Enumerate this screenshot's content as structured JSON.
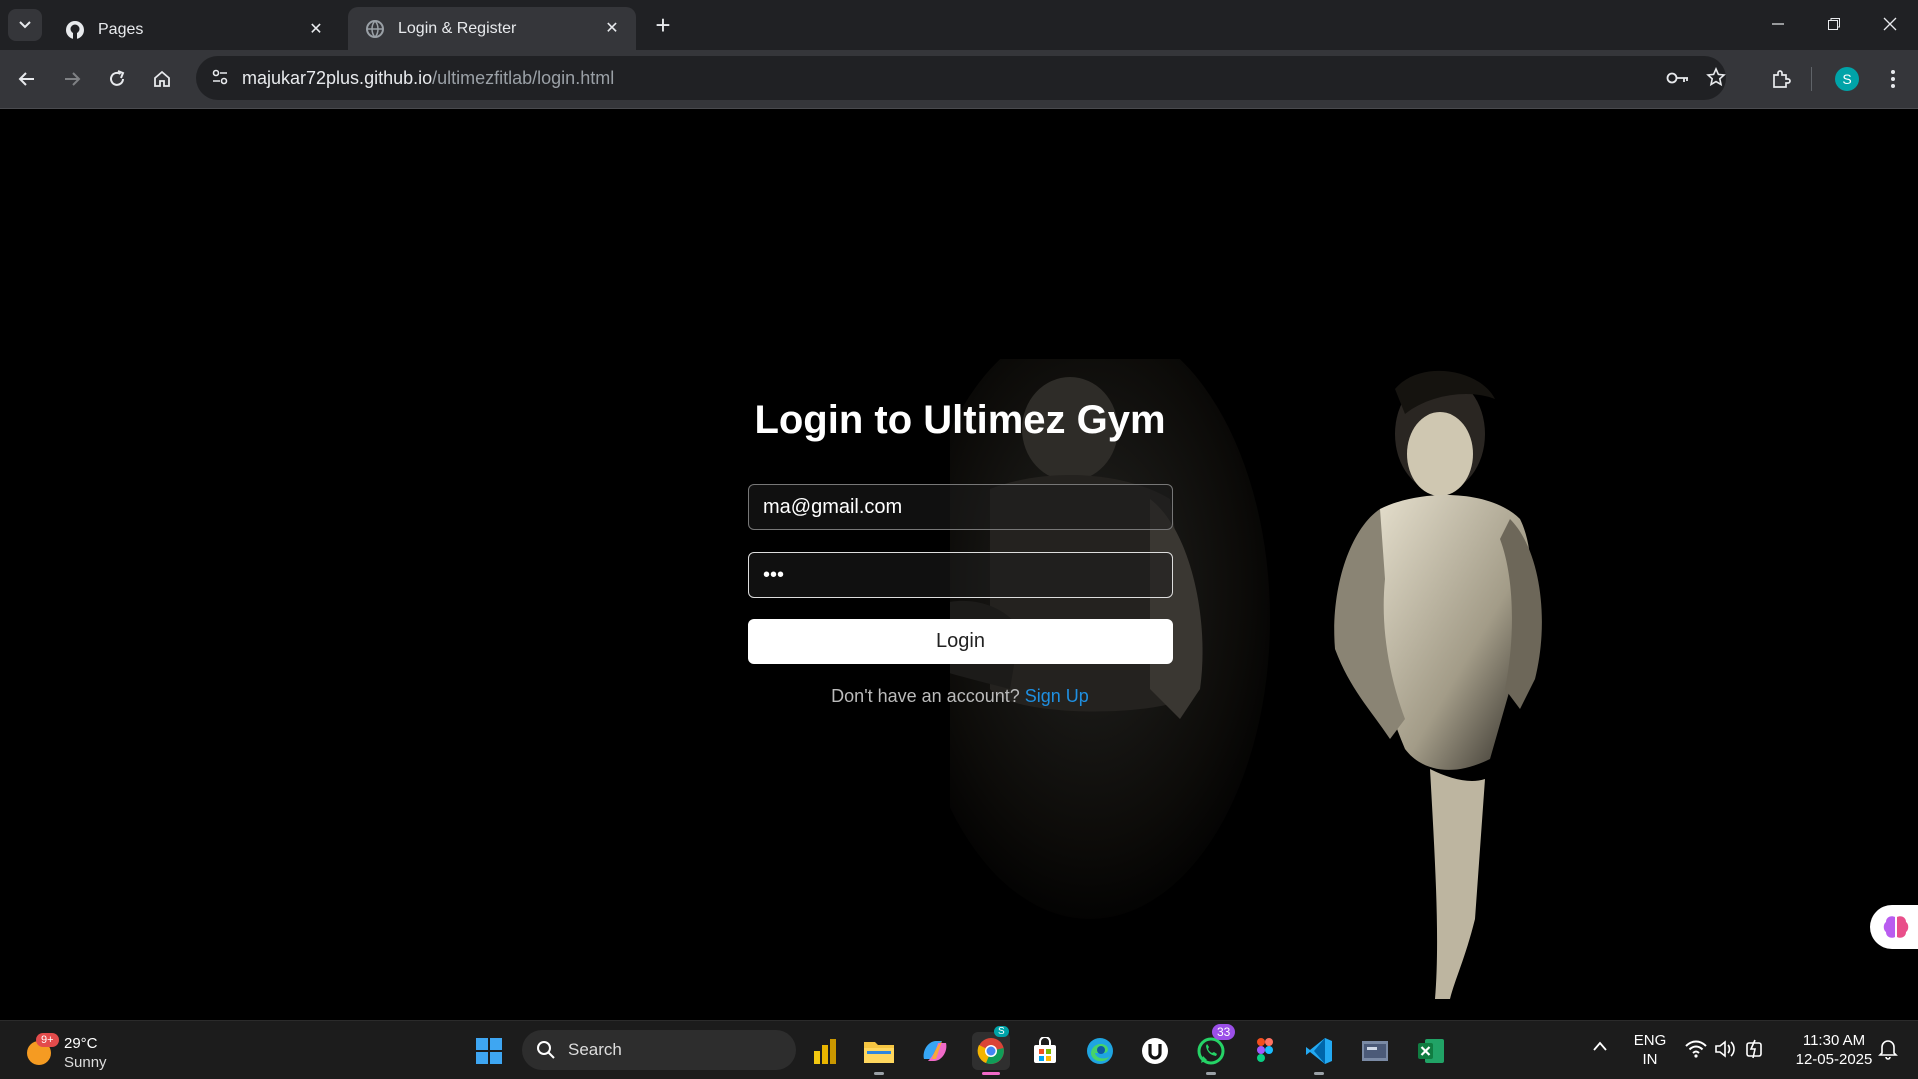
{
  "browser": {
    "tabs": [
      {
        "title": "Pages",
        "active": false,
        "icon": "github-icon"
      },
      {
        "title": "Login & Register",
        "active": true,
        "icon": "globe-icon"
      }
    ],
    "url_host": "majukar72plus.github.io",
    "url_path": "/ultimezfitlab/login.html",
    "profile_initial": "S"
  },
  "page": {
    "title": "Login to Ultimez Gym",
    "email_value": "ma@gmail.com",
    "password_value": "abc",
    "login_label": "Login",
    "signup_prompt": "Don't have an account?",
    "signup_link": "Sign Up"
  },
  "taskbar": {
    "weather_temp": "29°C",
    "weather_desc": "Sunny",
    "weather_badge": "9+",
    "search_label": "Search",
    "whatsapp_badge": "33",
    "chrome_badge": "S",
    "lang_top": "ENG",
    "lang_bottom": "IN",
    "time": "11:30 AM",
    "date": "12-05-2025"
  },
  "colors": {
    "link": "#1f8fe0",
    "tabbar": "#202124",
    "toolbar": "#35363a",
    "profile": "#00a3a8"
  }
}
